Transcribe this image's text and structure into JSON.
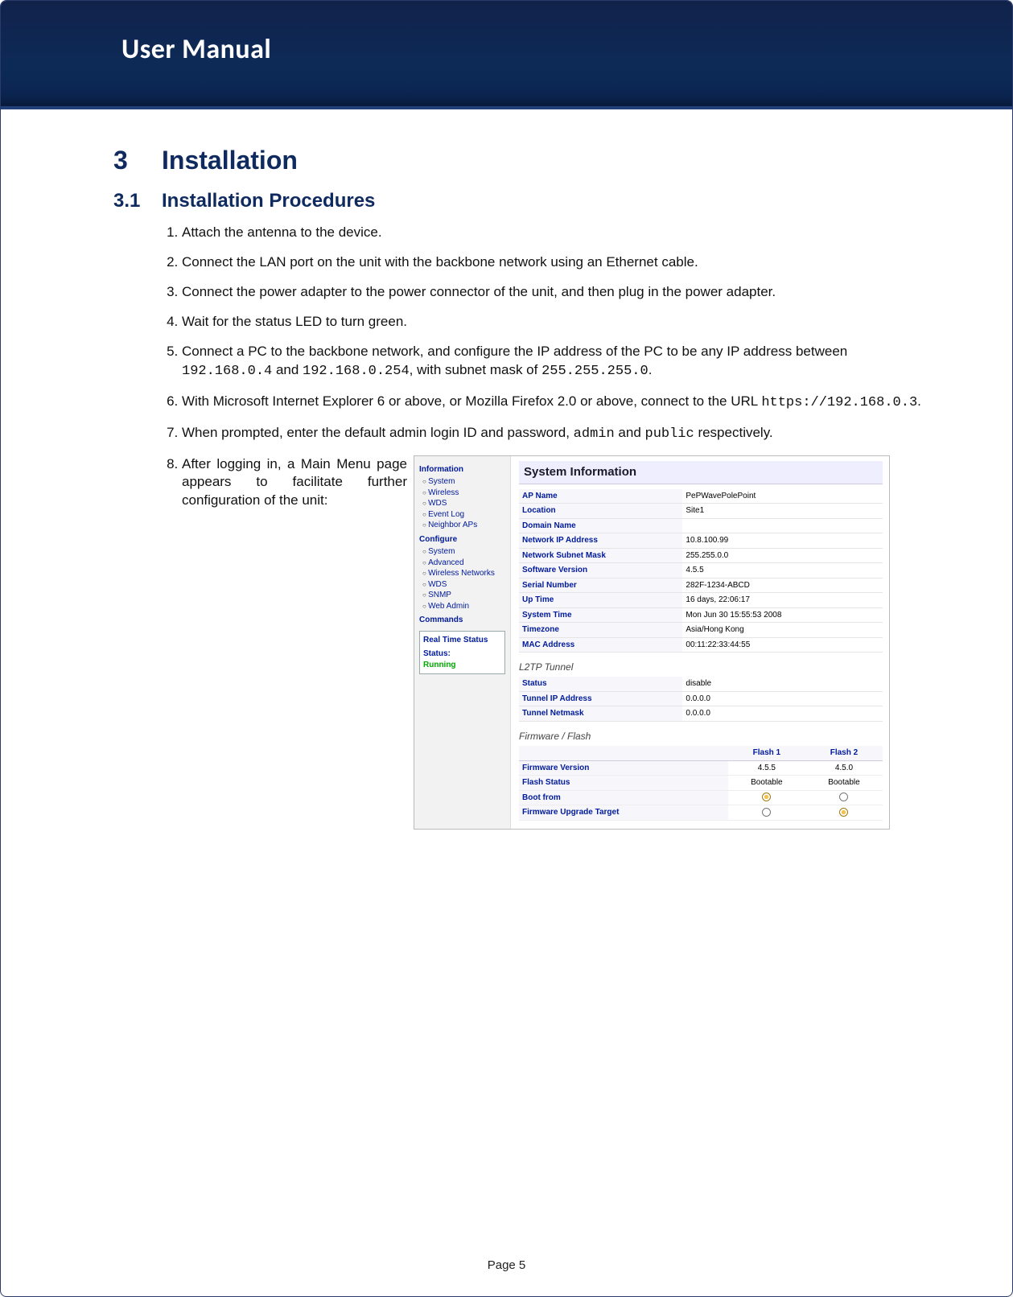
{
  "header": {
    "title": "User Manual"
  },
  "section": {
    "num": "3",
    "title": "Installation"
  },
  "subsection": {
    "num": "3.1",
    "title": "Installation Procedures"
  },
  "steps": {
    "s1": "Attach the antenna to the device.",
    "s2": "Connect the LAN port on the unit with the backbone network using an Ethernet cable.",
    "s3": "Connect the power adapter to the power connector of the unit, and then plug in the power adapter.",
    "s4": "Wait for the status LED to turn green.",
    "s5a": "Connect a PC to the backbone network, and configure the IP address of the PC to be any IP address between ",
    "s5_ip1": "192.168.0.4",
    "s5b": " and ",
    "s5_ip2": "192.168.0.254",
    "s5c": ", with subnet mask of ",
    "s5_mask": "255.255.255.0",
    "s5d": ".",
    "s6a": "With Microsoft Internet Explorer 6 or above, or Mozilla Firefox 2.0 or above, connect to the URL ",
    "s6_url": "https://192.168.0.3",
    "s6b": ".",
    "s7a": "When prompted, enter the default admin login ID and password, ",
    "s7_user": "admin",
    "s7b": " and ",
    "s7_pass": "public",
    "s7c": " respectively.",
    "s8": "After logging in, a Main Menu page appears to facilitate further configuration of the unit:"
  },
  "shot": {
    "sidebar": {
      "info_head": "Information",
      "info_items": [
        "System",
        "Wireless",
        "WDS",
        "Event Log",
        "Neighbor APs"
      ],
      "conf_head": "Configure",
      "conf_items": [
        "System",
        "Advanced",
        "Wireless Networks",
        "WDS",
        "SNMP",
        "Web Admin"
      ],
      "cmd_head": "Commands",
      "rt_title": "Real Time Status",
      "rt_status_label": "Status:",
      "rt_status_value": "Running"
    },
    "title": "System Information",
    "sys": [
      {
        "k": "AP Name",
        "v": "PePWavePolePoint"
      },
      {
        "k": "Location",
        "v": "Site1"
      },
      {
        "k": "Domain Name",
        "v": ""
      },
      {
        "k": "Network IP Address",
        "v": "10.8.100.99"
      },
      {
        "k": "Network Subnet Mask",
        "v": "255.255.0.0"
      },
      {
        "k": "Software Version",
        "v": "4.5.5"
      },
      {
        "k": "Serial Number",
        "v": "282F-1234-ABCD"
      },
      {
        "k": "Up Time",
        "v": "16 days, 22:06:17"
      },
      {
        "k": "System Time",
        "v": "Mon Jun 30 15:55:53 2008"
      },
      {
        "k": "Timezone",
        "v": "Asia/Hong Kong"
      },
      {
        "k": "MAC Address",
        "v": "00:11:22:33:44:55"
      }
    ],
    "l2tp_title": "L2TP Tunnel",
    "l2tp": [
      {
        "k": "Status",
        "v": "disable"
      },
      {
        "k": "Tunnel IP Address",
        "v": "0.0.0.0"
      },
      {
        "k": "Tunnel Netmask",
        "v": "0.0.0.0"
      }
    ],
    "fw_title": "Firmware / Flash",
    "fw_headers": {
      "c1": "",
      "c2": "Flash 1",
      "c3": "Flash 2"
    },
    "fw_rows": [
      {
        "k": "Firmware Version",
        "a": "4.5.5",
        "b": "4.5.0"
      },
      {
        "k": "Flash Status",
        "a": "Bootable",
        "b": "Bootable"
      }
    ],
    "fw_boot_label": "Boot from",
    "fw_upgrade_label": "Firmware Upgrade Target"
  },
  "footer": {
    "page": "Page 5"
  }
}
